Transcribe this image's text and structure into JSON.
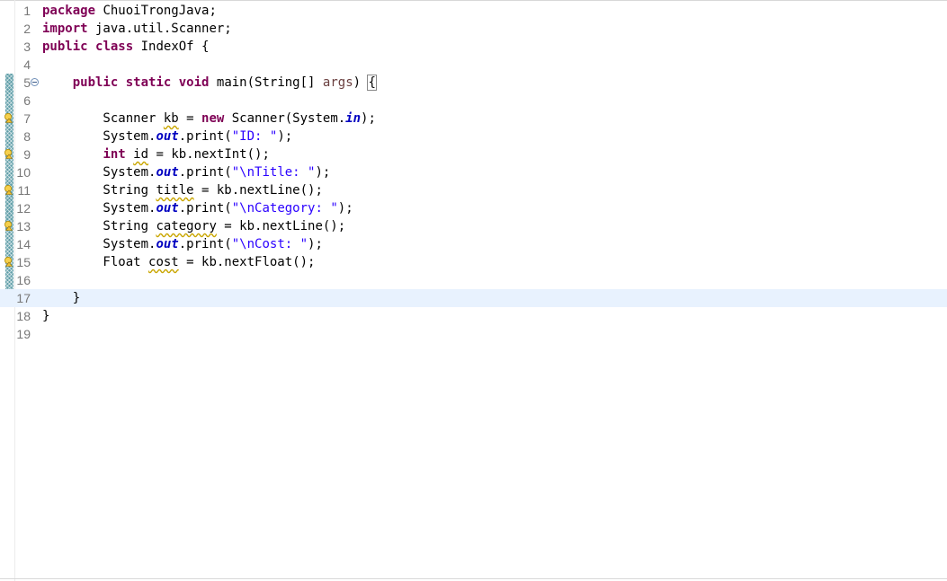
{
  "editor": {
    "lines": [
      {
        "n": "1",
        "tokens": [
          {
            "t": "package",
            "c": "kw"
          },
          {
            "t": " ChuoiTrongJava;"
          }
        ]
      },
      {
        "n": "2",
        "tokens": [
          {
            "t": "import",
            "c": "kw"
          },
          {
            "t": " java.util.Scanner;"
          }
        ]
      },
      {
        "n": "3",
        "tokens": [
          {
            "t": "public",
            "c": "kw"
          },
          {
            "t": " "
          },
          {
            "t": "class",
            "c": "kw"
          },
          {
            "t": " IndexOf {"
          }
        ]
      },
      {
        "n": "4",
        "tokens": []
      },
      {
        "n": "5",
        "fold": true,
        "tokens": [
          {
            "t": "    "
          },
          {
            "t": "public",
            "c": "kw"
          },
          {
            "t": " "
          },
          {
            "t": "static",
            "c": "kw"
          },
          {
            "t": " "
          },
          {
            "t": "void",
            "c": "kw"
          },
          {
            "t": " main(String[] "
          },
          {
            "t": "args",
            "c": "param"
          },
          {
            "t": ") "
          },
          {
            "t": "{",
            "c": "bracket"
          }
        ]
      },
      {
        "n": "6",
        "tokens": []
      },
      {
        "n": "7",
        "warning": true,
        "tokens": [
          {
            "t": "        Scanner "
          },
          {
            "t": "kb",
            "c": "warn-var"
          },
          {
            "t": " = "
          },
          {
            "t": "new",
            "c": "kw"
          },
          {
            "t": " Scanner(System."
          },
          {
            "t": "in",
            "c": "field"
          },
          {
            "t": ");"
          }
        ]
      },
      {
        "n": "8",
        "tokens": [
          {
            "t": "        System."
          },
          {
            "t": "out",
            "c": "field"
          },
          {
            "t": ".print("
          },
          {
            "t": "\"ID: \"",
            "c": "str"
          },
          {
            "t": ");"
          }
        ]
      },
      {
        "n": "9",
        "warning": true,
        "tokens": [
          {
            "t": "        "
          },
          {
            "t": "int",
            "c": "kw"
          },
          {
            "t": " "
          },
          {
            "t": "id",
            "c": "warn-var"
          },
          {
            "t": " = kb.nextInt();"
          }
        ]
      },
      {
        "n": "10",
        "tokens": [
          {
            "t": "        System."
          },
          {
            "t": "out",
            "c": "field"
          },
          {
            "t": ".print("
          },
          {
            "t": "\"\\nTitle: \"",
            "c": "str"
          },
          {
            "t": ");"
          }
        ]
      },
      {
        "n": "11",
        "warning": true,
        "tokens": [
          {
            "t": "        String "
          },
          {
            "t": "title",
            "c": "warn-var"
          },
          {
            "t": " = kb.nextLine();"
          }
        ]
      },
      {
        "n": "12",
        "tokens": [
          {
            "t": "        System."
          },
          {
            "t": "out",
            "c": "field"
          },
          {
            "t": ".print("
          },
          {
            "t": "\"\\nCategory: \"",
            "c": "str"
          },
          {
            "t": ");"
          }
        ]
      },
      {
        "n": "13",
        "warning": true,
        "tokens": [
          {
            "t": "        String "
          },
          {
            "t": "category",
            "c": "warn-var"
          },
          {
            "t": " = kb.nextLine();"
          }
        ]
      },
      {
        "n": "14",
        "tokens": [
          {
            "t": "        System."
          },
          {
            "t": "out",
            "c": "field"
          },
          {
            "t": ".print("
          },
          {
            "t": "\"\\nCost: \"",
            "c": "str"
          },
          {
            "t": ");"
          }
        ]
      },
      {
        "n": "15",
        "warning": true,
        "tokens": [
          {
            "t": "        Float "
          },
          {
            "t": "cost",
            "c": "warn-var"
          },
          {
            "t": " = kb.nextFloat();"
          }
        ]
      },
      {
        "n": "16",
        "tokens": []
      },
      {
        "n": "17",
        "current": true,
        "tokens": [
          {
            "t": "    }"
          }
        ]
      },
      {
        "n": "18",
        "tokens": [
          {
            "t": "}"
          }
        ]
      },
      {
        "n": "19",
        "tokens": []
      }
    ]
  }
}
